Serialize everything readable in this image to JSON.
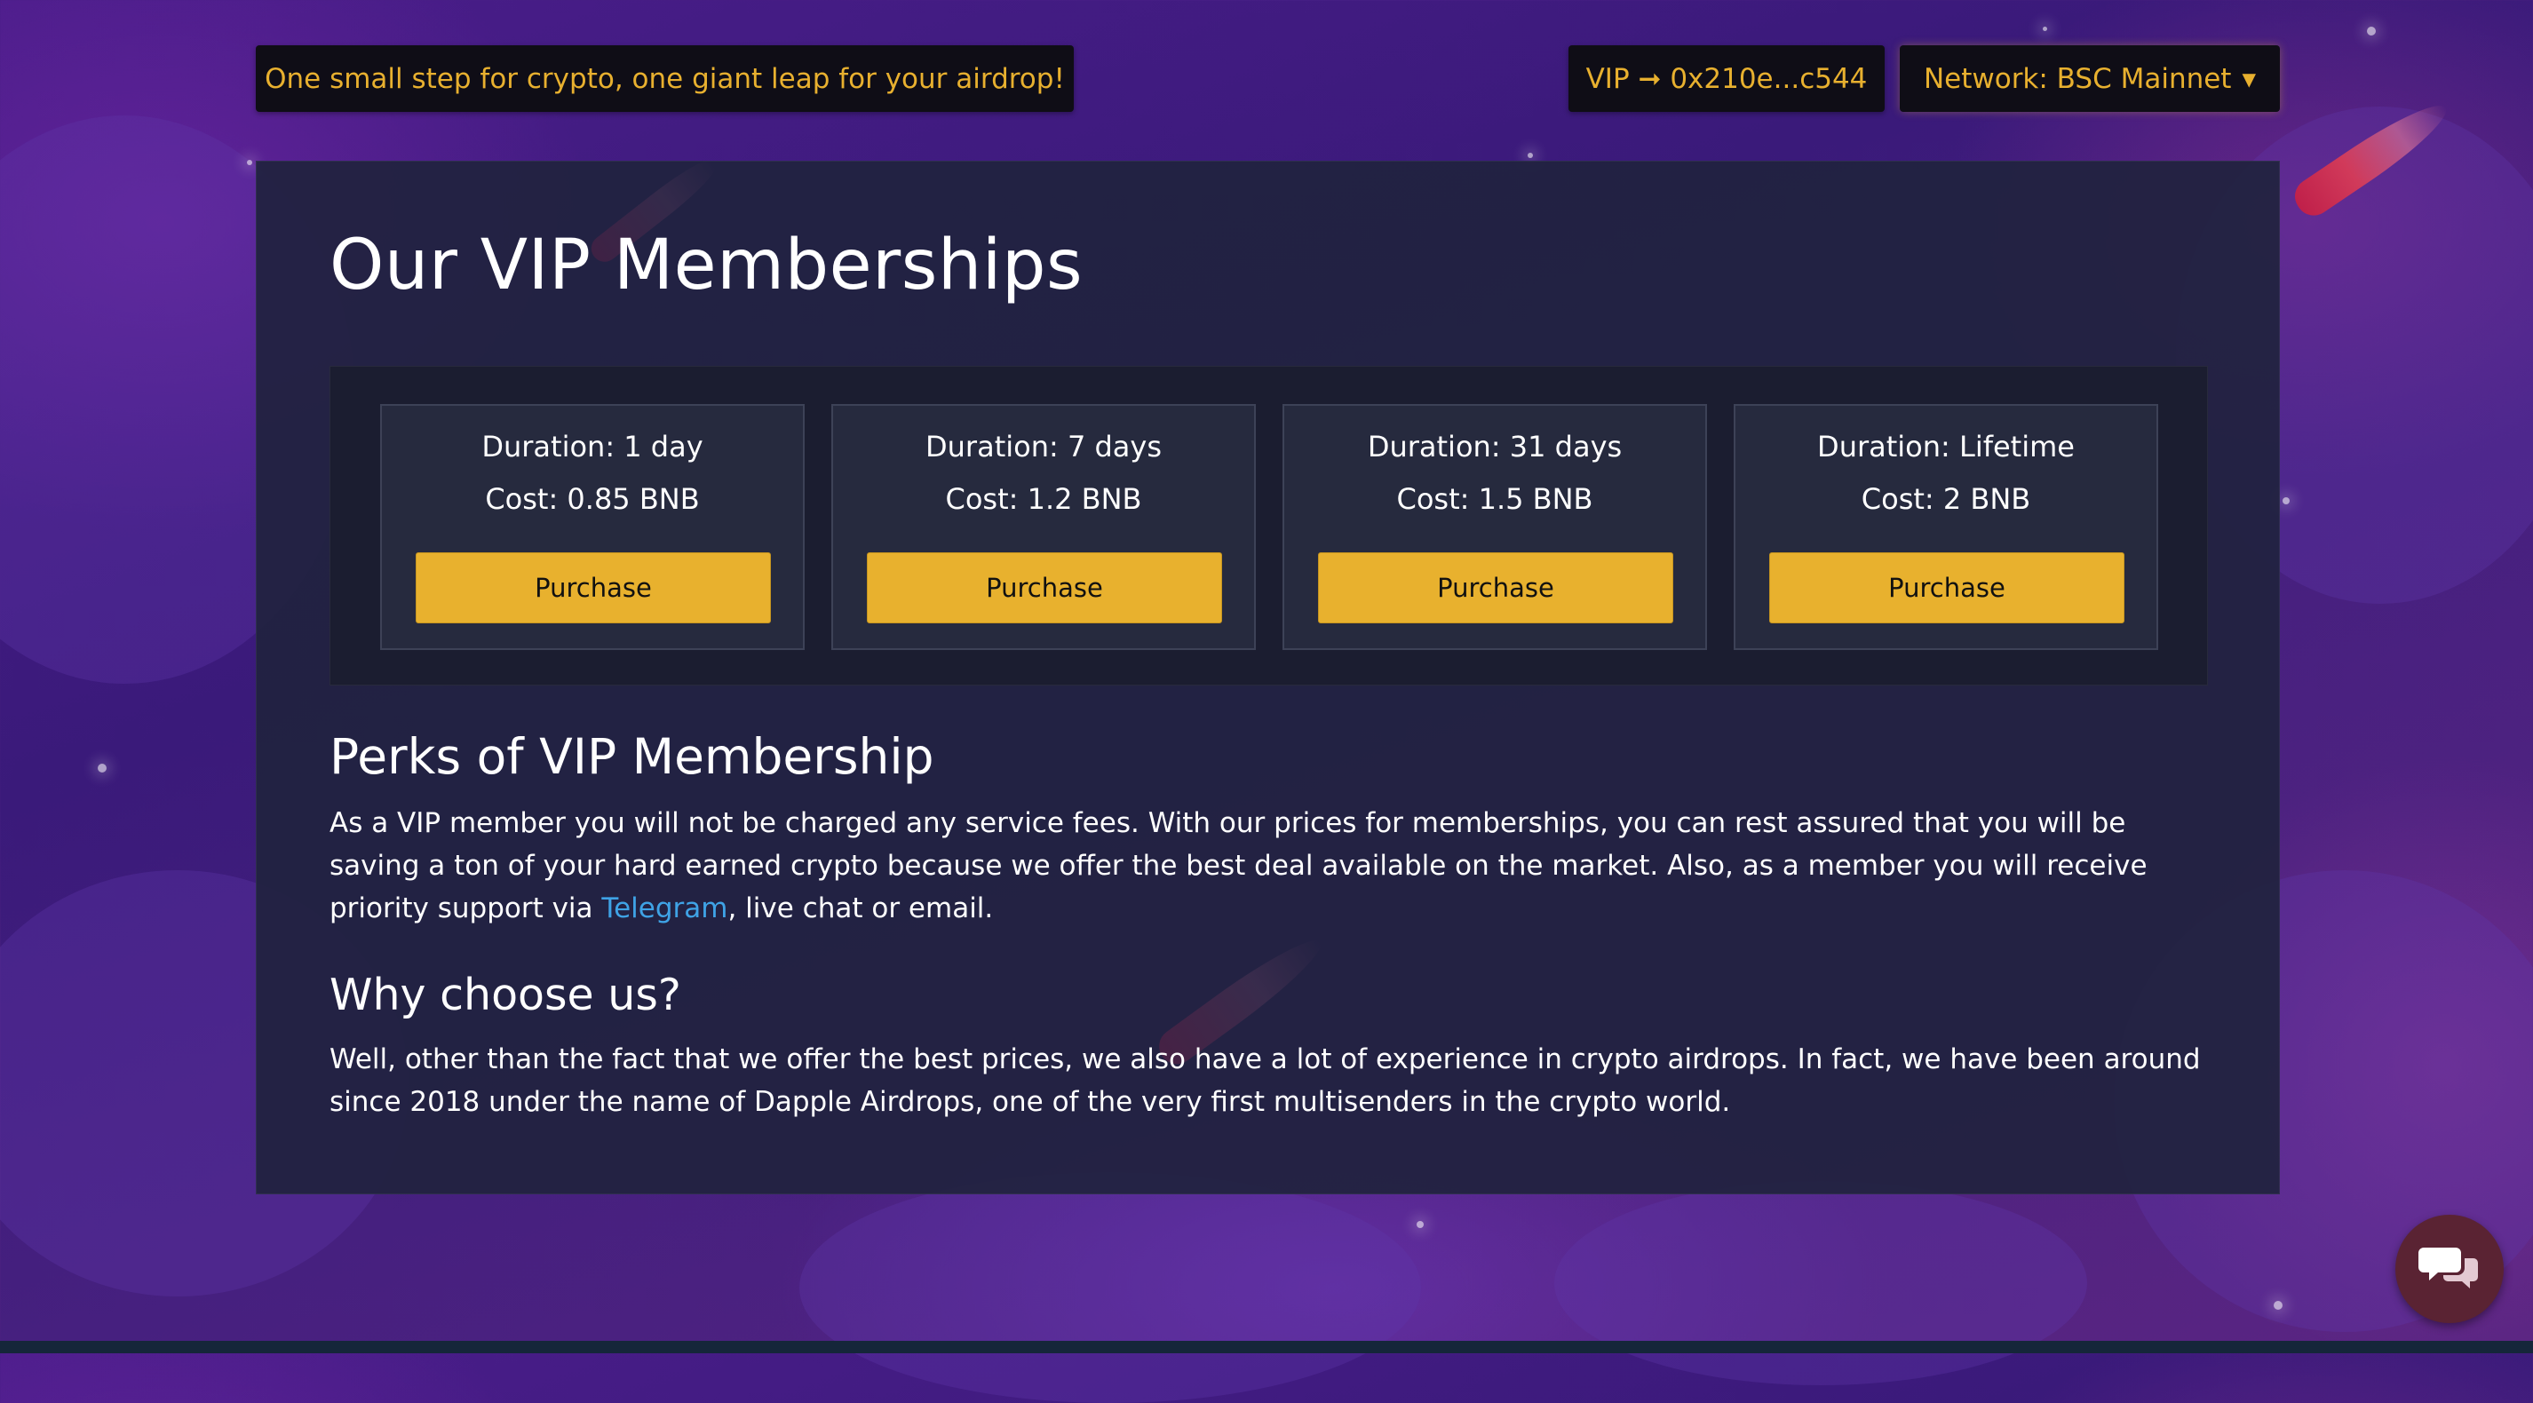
{
  "header": {
    "tagline": "One small step for crypto, one giant leap for your airdrop!",
    "vip_label": "VIP ➞ 0x210e...c544",
    "network_label": "Network: BSC Mainnet",
    "network_chevron": "▾"
  },
  "main": {
    "title": "Our VIP Memberships",
    "plans": [
      {
        "duration": "Duration: 1 day",
        "cost": "Cost: 0.85 BNB",
        "button": "Purchase"
      },
      {
        "duration": "Duration: 7 days",
        "cost": "Cost: 1.2 BNB",
        "button": "Purchase"
      },
      {
        "duration": "Duration: 31 days",
        "cost": "Cost: 1.5 BNB",
        "button": "Purchase"
      },
      {
        "duration": "Duration: Lifetime",
        "cost": "Cost: 2 BNB",
        "button": "Purchase"
      }
    ],
    "perks": {
      "heading": "Perks of VIP Membership",
      "text_before": "As a VIP member you will not be charged any service fees. With our prices for memberships, you can rest assured that you will be saving a ton of your hard earned crypto because we offer the best deal available on the market. Also, as a member you will receive priority support via ",
      "link_text": "Telegram",
      "text_after": ", live chat or email."
    },
    "why": {
      "heading": "Why choose us?",
      "text": "Well, other than the fact that we offer the best prices, we also have a lot of experience in crypto airdrops. In fact, we have been around since 2018 under the name of Dapple Airdrops, one of the very first multisenders in the crypto world."
    }
  },
  "chat_widget": {
    "icon": "chat-bubbles-icon"
  },
  "colors": {
    "accent": "#e8b12e",
    "link": "#3fa3e6",
    "panel": "#20223e",
    "background": "#3a1a7a"
  }
}
